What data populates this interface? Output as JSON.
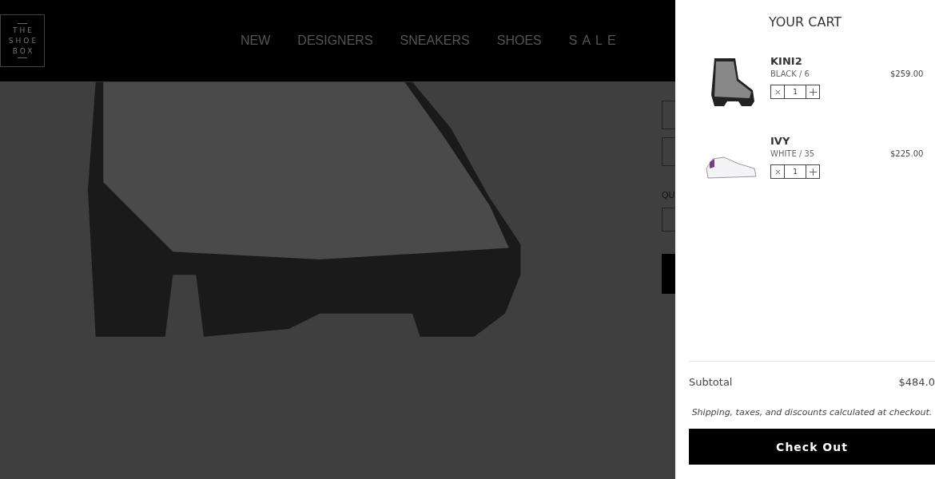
{
  "logo": {
    "lines": [
      "THE",
      "SHOE",
      "BOX"
    ]
  },
  "nav": [
    "NEW",
    "DESIGNERS",
    "SNEAKERS",
    "SHOES",
    "SALE"
  ],
  "product_page": {
    "quantity_label": "QU"
  },
  "cart": {
    "title": "YOUR CART",
    "items": [
      {
        "name": "KINI2",
        "variant": "BLACK / 6",
        "price": "$259.00",
        "quantity": "1",
        "kind": "boot"
      },
      {
        "name": "IVY",
        "variant": "WHITE / 35",
        "price": "$225.00",
        "quantity": "1",
        "kind": "sneaker"
      }
    ],
    "subtotal_label": "Subtotal",
    "subtotal": "$484.0",
    "note": "Shipping, taxes, and discounts calculated at checkout.",
    "checkout": "Check Out"
  }
}
